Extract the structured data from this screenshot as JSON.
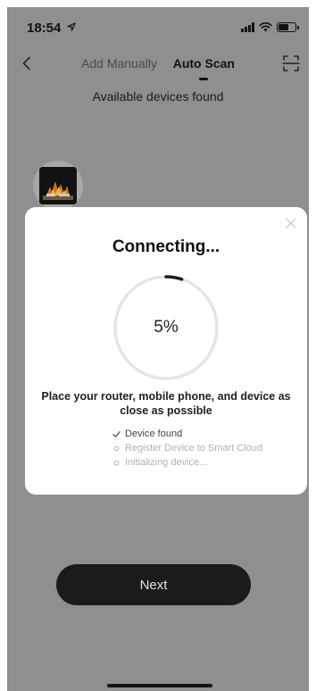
{
  "status_bar": {
    "time": "18:54",
    "location_icon": "location-arrow-icon",
    "signal_icon": "cellular-signal-icon",
    "wifi_icon": "wifi-icon",
    "battery_icon": "battery-icon",
    "battery_level": 0.6
  },
  "nav": {
    "back_icon": "chevron-left-icon",
    "tabs": [
      {
        "label": "Add Manually",
        "active": false
      },
      {
        "label": "Auto Scan",
        "active": true
      }
    ],
    "scan_icon": "scan-frame-icon"
  },
  "found_title": "Available devices found",
  "device": {
    "image": "fireplace-thumbnail"
  },
  "modal": {
    "close_icon": "close-icon",
    "title": "Connecting...",
    "progress_percent": 5,
    "progress_label": "5%",
    "message": "Place your router, mobile phone, and device as close as possible",
    "steps": [
      {
        "label": "Device found",
        "status": "done",
        "icon": "check-icon"
      },
      {
        "label": "Register Device to Smart Cloud",
        "status": "pending",
        "icon": "circle-icon"
      },
      {
        "label": "Initializing device...",
        "status": "pending",
        "icon": "circle-icon"
      }
    ]
  },
  "next_button": {
    "label": "Next"
  },
  "colors": {
    "overlay": "#8f8f8f",
    "modal_bg": "#ffffff",
    "progress_track": "#e5e5e5",
    "progress_arc": "#1b1b1b",
    "button_bg": "#1b1b1b",
    "pending_text": "#b0b0b0"
  }
}
